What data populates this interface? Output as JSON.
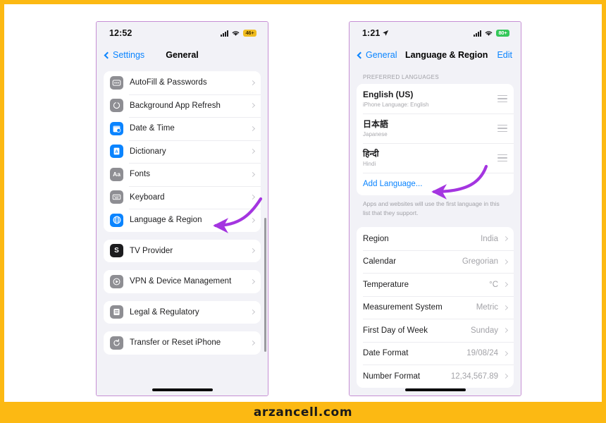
{
  "brand": {
    "text": "arzancell.com",
    "color": "#fcb913"
  },
  "phone_left": {
    "status": {
      "time": "12:52",
      "signal_icon": "cellular-bars-icon",
      "wifi_icon": "wifi-icon",
      "battery": "46+",
      "battery_color": "#f0bc1f"
    },
    "nav": {
      "back_label": "Settings",
      "title": "General"
    },
    "groups": [
      {
        "rows": [
          {
            "label": "AutoFill & Passwords",
            "icon": "autofill-passwords-icon",
            "icon_style": "gray",
            "glyph": "▤"
          },
          {
            "label": "Background App Refresh",
            "icon": "background-app-refresh-icon",
            "icon_style": "gray",
            "glyph": "◯"
          },
          {
            "label": "Date & Time",
            "icon": "date-time-icon",
            "icon_style": "blue",
            "glyph": "Ὕ3"
          },
          {
            "label": "Dictionary",
            "icon": "dictionary-icon",
            "icon_style": "blue",
            "glyph": "A"
          },
          {
            "label": "Fonts",
            "icon": "fonts-icon",
            "icon_style": "gray",
            "glyph": "Aa"
          },
          {
            "label": "Keyboard",
            "icon": "keyboard-icon",
            "icon_style": "gray",
            "glyph": "⌨"
          },
          {
            "label": "Language & Region",
            "icon": "language-region-icon",
            "icon_style": "blue",
            "glyph": "ἱ0"
          }
        ]
      },
      {
        "rows": [
          {
            "label": "TV Provider",
            "icon": "tv-provider-icon",
            "icon_style": "black",
            "glyph": "S"
          }
        ]
      },
      {
        "rows": [
          {
            "label": "VPN & Device Management",
            "icon": "vpn-device-management-icon",
            "icon_style": "gray",
            "glyph": "▶"
          }
        ]
      },
      {
        "rows": [
          {
            "label": "Legal & Regulatory",
            "icon": "legal-regulatory-icon",
            "icon_style": "gray",
            "glyph": "≡"
          }
        ]
      },
      {
        "rows": [
          {
            "label": "Transfer or Reset iPhone",
            "icon": "transfer-reset-iphone-icon",
            "icon_style": "gray",
            "glyph": "↺"
          }
        ]
      }
    ]
  },
  "phone_right": {
    "status": {
      "time": "1:21",
      "location_icon": "location-arrow-icon",
      "signal_icon": "cellular-bars-icon",
      "wifi_icon": "wifi-icon",
      "battery": "80+",
      "battery_color": "#34c759"
    },
    "nav": {
      "back_label": "General",
      "title": "Language & Region",
      "edit_label": "Edit"
    },
    "preferred_caption": "PREFERRED LANGUAGES",
    "languages": [
      {
        "name": "English (US)",
        "sub": "iPhone Language: English",
        "handle": "reorder-handle-icon"
      },
      {
        "name": "日本語",
        "sub": "Japanese",
        "handle": "reorder-handle-icon"
      },
      {
        "name": "हिन्दी",
        "sub": "Hindi",
        "handle": "reorder-handle-icon"
      }
    ],
    "add_language_label": "Add Language...",
    "footnote": "Apps and websites will use the first language in this list that they support.",
    "settings": [
      {
        "label": "Region",
        "value": "India"
      },
      {
        "label": "Calendar",
        "value": "Gregorian"
      },
      {
        "label": "Temperature",
        "value": "°C"
      },
      {
        "label": "Measurement System",
        "value": "Metric"
      },
      {
        "label": "First Day of Week",
        "value": "Sunday"
      },
      {
        "label": "Date Format",
        "value": "19/08/24"
      },
      {
        "label": "Number Format",
        "value": "12,34,567.89"
      }
    ]
  },
  "annotations": {
    "arrow_color": "#a435e0",
    "left_arrow": "arrow-pointing-to-language-region",
    "right_arrow": "arrow-pointing-to-add-language"
  }
}
